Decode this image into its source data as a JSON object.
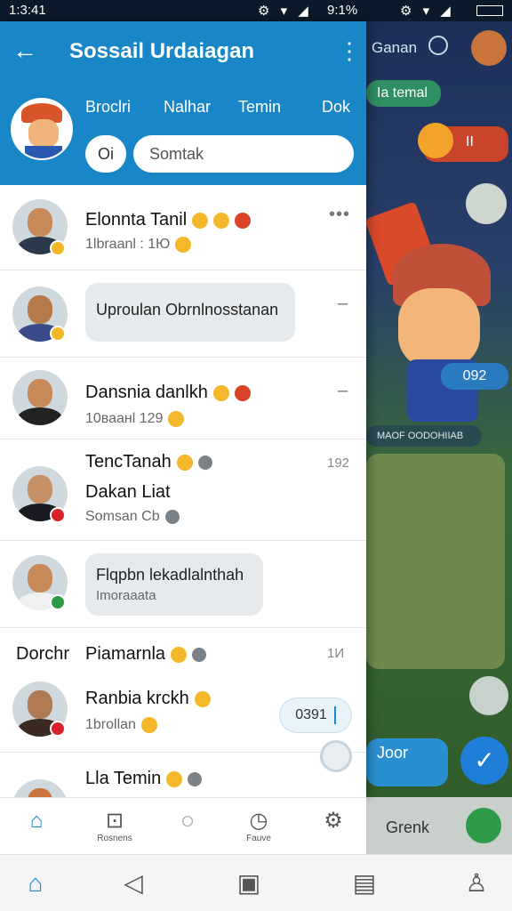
{
  "status_bar": {
    "time": "1:3:41",
    "battery_left": "9:1%"
  },
  "header": {
    "title": "Sossail Urdaiagan",
    "tabs": [
      "Broclri",
      "Nalhar",
      "Temin",
      "Dok"
    ],
    "pill": "Oi",
    "search_placeholder": "Somtak"
  },
  "chats": [
    {
      "name": "Elonnta Tanil",
      "sub": "1lbraanl : 1Ю"
    },
    {
      "bubble": "Uproulan Obrnlnosstanan"
    },
    {
      "name": "Dansnia danlkh",
      "sub": "10ваанl 129"
    },
    {
      "name": "TencTanah",
      "name2": "Dakan Liat",
      "sub": "Somsan  Cb",
      "count": "192"
    },
    {
      "bubble": "Flqpbn lekadlalnthah",
      "bubble_sub": "Imoraaata"
    },
    {
      "section": "Dorchr",
      "name": "Piamarnla",
      "count": "1И"
    },
    {
      "name": "Ranbia krckh",
      "sub": "1brollan",
      "pill": "0391"
    },
    {
      "name": "Lla Temin"
    }
  ],
  "app_tabs": [
    {
      "icon": "home-icon",
      "label": ""
    },
    {
      "icon": "pot-icon",
      "label": "Rosnens"
    },
    {
      "icon": "chat-icon",
      "label": ""
    },
    {
      "icon": "clock-icon",
      "label": "Fauve"
    },
    {
      "icon": "settings-icon",
      "label": ""
    }
  ],
  "background_app": {
    "search": "Ganan",
    "bubble1": "Ia temal",
    "bubble2": "II",
    "bubble3": "092",
    "bubble4": "MAOF OODOHIIAB",
    "bubble5": "Joor",
    "bottom_label": "Grenk"
  },
  "colors": {
    "accent": "#1986c8",
    "background": "#ffffff"
  }
}
